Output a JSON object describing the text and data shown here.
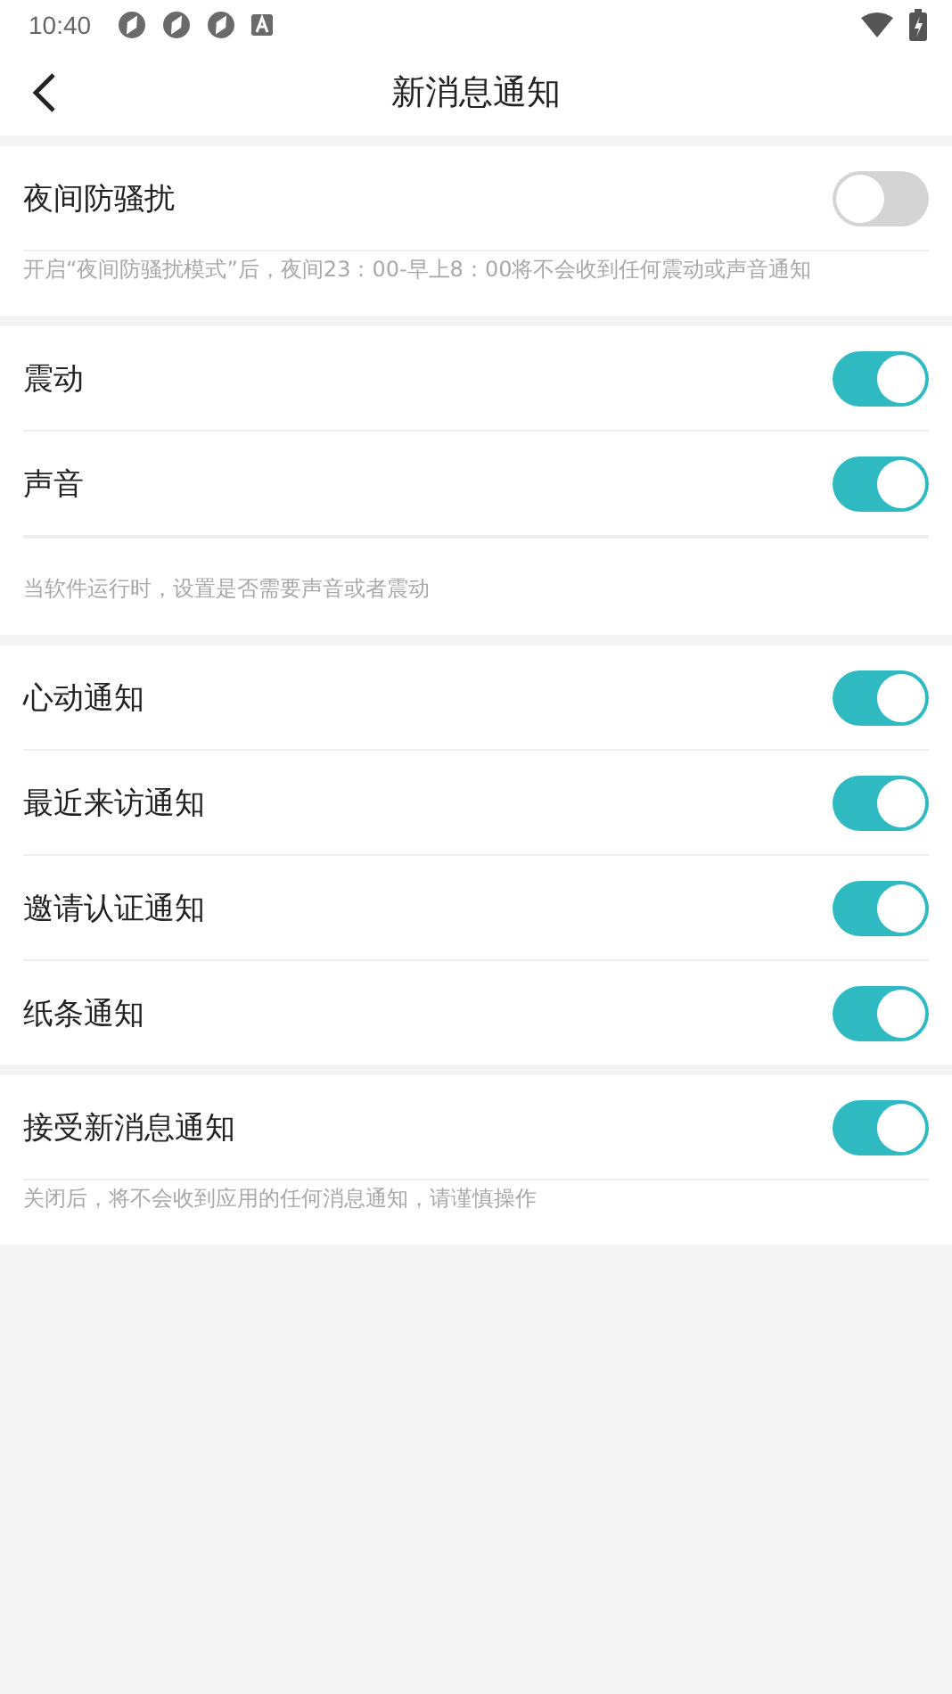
{
  "status_bar": {
    "time": "10:40"
  },
  "header": {
    "title": "新消息通知"
  },
  "sections": [
    {
      "rows": [
        {
          "label": "夜间防骚扰",
          "on": false
        }
      ],
      "hint": "开启“夜间防骚扰模式”后，夜间23：00-早上8：00将不会收到任何震动或声音通知"
    },
    {
      "rows": [
        {
          "label": "震动",
          "on": true
        },
        {
          "label": "声音",
          "on": true
        }
      ],
      "hint": "当软件运行时，设置是否需要声音或者震动"
    },
    {
      "rows": [
        {
          "label": "心动通知",
          "on": true
        },
        {
          "label": "最近来访通知",
          "on": true
        },
        {
          "label": "邀请认证通知",
          "on": true
        },
        {
          "label": "纸条通知",
          "on": true
        }
      ]
    },
    {
      "rows": [
        {
          "label": "接受新消息通知",
          "on": true
        }
      ],
      "hint": "关闭后，将不会收到应用的任何消息通知，请谨慎操作"
    }
  ]
}
